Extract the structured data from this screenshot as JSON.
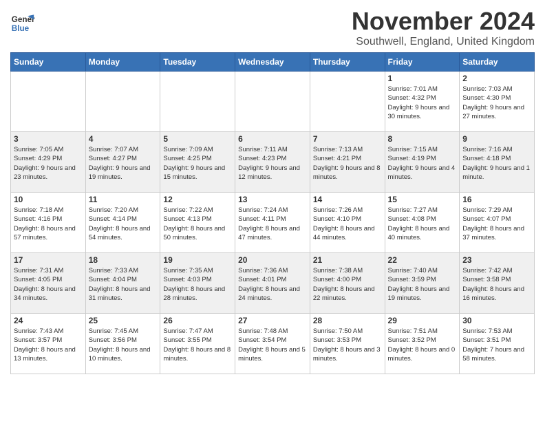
{
  "logo": {
    "line1": "General",
    "line2": "Blue"
  },
  "title": "November 2024",
  "location": "Southwell, England, United Kingdom",
  "weekdays": [
    "Sunday",
    "Monday",
    "Tuesday",
    "Wednesday",
    "Thursday",
    "Friday",
    "Saturday"
  ],
  "weeks": [
    [
      {
        "day": "",
        "info": ""
      },
      {
        "day": "",
        "info": ""
      },
      {
        "day": "",
        "info": ""
      },
      {
        "day": "",
        "info": ""
      },
      {
        "day": "",
        "info": ""
      },
      {
        "day": "1",
        "info": "Sunrise: 7:01 AM\nSunset: 4:32 PM\nDaylight: 9 hours and 30 minutes."
      },
      {
        "day": "2",
        "info": "Sunrise: 7:03 AM\nSunset: 4:30 PM\nDaylight: 9 hours and 27 minutes."
      }
    ],
    [
      {
        "day": "3",
        "info": "Sunrise: 7:05 AM\nSunset: 4:29 PM\nDaylight: 9 hours and 23 minutes."
      },
      {
        "day": "4",
        "info": "Sunrise: 7:07 AM\nSunset: 4:27 PM\nDaylight: 9 hours and 19 minutes."
      },
      {
        "day": "5",
        "info": "Sunrise: 7:09 AM\nSunset: 4:25 PM\nDaylight: 9 hours and 15 minutes."
      },
      {
        "day": "6",
        "info": "Sunrise: 7:11 AM\nSunset: 4:23 PM\nDaylight: 9 hours and 12 minutes."
      },
      {
        "day": "7",
        "info": "Sunrise: 7:13 AM\nSunset: 4:21 PM\nDaylight: 9 hours and 8 minutes."
      },
      {
        "day": "8",
        "info": "Sunrise: 7:15 AM\nSunset: 4:19 PM\nDaylight: 9 hours and 4 minutes."
      },
      {
        "day": "9",
        "info": "Sunrise: 7:16 AM\nSunset: 4:18 PM\nDaylight: 9 hours and 1 minute."
      }
    ],
    [
      {
        "day": "10",
        "info": "Sunrise: 7:18 AM\nSunset: 4:16 PM\nDaylight: 8 hours and 57 minutes."
      },
      {
        "day": "11",
        "info": "Sunrise: 7:20 AM\nSunset: 4:14 PM\nDaylight: 8 hours and 54 minutes."
      },
      {
        "day": "12",
        "info": "Sunrise: 7:22 AM\nSunset: 4:13 PM\nDaylight: 8 hours and 50 minutes."
      },
      {
        "day": "13",
        "info": "Sunrise: 7:24 AM\nSunset: 4:11 PM\nDaylight: 8 hours and 47 minutes."
      },
      {
        "day": "14",
        "info": "Sunrise: 7:26 AM\nSunset: 4:10 PM\nDaylight: 8 hours and 44 minutes."
      },
      {
        "day": "15",
        "info": "Sunrise: 7:27 AM\nSunset: 4:08 PM\nDaylight: 8 hours and 40 minutes."
      },
      {
        "day": "16",
        "info": "Sunrise: 7:29 AM\nSunset: 4:07 PM\nDaylight: 8 hours and 37 minutes."
      }
    ],
    [
      {
        "day": "17",
        "info": "Sunrise: 7:31 AM\nSunset: 4:05 PM\nDaylight: 8 hours and 34 minutes."
      },
      {
        "day": "18",
        "info": "Sunrise: 7:33 AM\nSunset: 4:04 PM\nDaylight: 8 hours and 31 minutes."
      },
      {
        "day": "19",
        "info": "Sunrise: 7:35 AM\nSunset: 4:03 PM\nDaylight: 8 hours and 28 minutes."
      },
      {
        "day": "20",
        "info": "Sunrise: 7:36 AM\nSunset: 4:01 PM\nDaylight: 8 hours and 24 minutes."
      },
      {
        "day": "21",
        "info": "Sunrise: 7:38 AM\nSunset: 4:00 PM\nDaylight: 8 hours and 22 minutes."
      },
      {
        "day": "22",
        "info": "Sunrise: 7:40 AM\nSunset: 3:59 PM\nDaylight: 8 hours and 19 minutes."
      },
      {
        "day": "23",
        "info": "Sunrise: 7:42 AM\nSunset: 3:58 PM\nDaylight: 8 hours and 16 minutes."
      }
    ],
    [
      {
        "day": "24",
        "info": "Sunrise: 7:43 AM\nSunset: 3:57 PM\nDaylight: 8 hours and 13 minutes."
      },
      {
        "day": "25",
        "info": "Sunrise: 7:45 AM\nSunset: 3:56 PM\nDaylight: 8 hours and 10 minutes."
      },
      {
        "day": "26",
        "info": "Sunrise: 7:47 AM\nSunset: 3:55 PM\nDaylight: 8 hours and 8 minutes."
      },
      {
        "day": "27",
        "info": "Sunrise: 7:48 AM\nSunset: 3:54 PM\nDaylight: 8 hours and 5 minutes."
      },
      {
        "day": "28",
        "info": "Sunrise: 7:50 AM\nSunset: 3:53 PM\nDaylight: 8 hours and 3 minutes."
      },
      {
        "day": "29",
        "info": "Sunrise: 7:51 AM\nSunset: 3:52 PM\nDaylight: 8 hours and 0 minutes."
      },
      {
        "day": "30",
        "info": "Sunrise: 7:53 AM\nSunset: 3:51 PM\nDaylight: 7 hours and 58 minutes."
      }
    ]
  ]
}
